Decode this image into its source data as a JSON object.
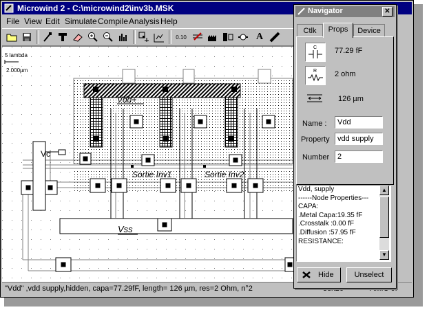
{
  "window": {
    "title": "Microwind 2 - C:\\microwind2\\inv3b.MSK"
  },
  "menu": [
    "File",
    "View",
    "Edit",
    "Simulate",
    "Compile",
    "Analysis",
    "Help"
  ],
  "toolbar": {
    "icons": [
      "open-folder-icon",
      "save-icon",
      "draw-box-icon",
      "draw-contact-icon",
      "eraser-icon",
      "zoom-in-icon",
      "zoom-out-icon",
      "view-all-icon",
      "simulate-icon",
      "measure-icon",
      "rotate-icon",
      "bus-icon",
      "process-icon",
      "wire-icon",
      "text-icon",
      "cut-icon"
    ],
    "scale_label": "0.10"
  },
  "canvas": {
    "scale_lambda": "5 lambda",
    "scale_um": "2.000µm",
    "labels": {
      "vdd": "Vdd+",
      "vc": "Vc",
      "sortie1": "Sortie Inv1",
      "sortie2": "Sortie Inv2",
      "vss": "Vss"
    }
  },
  "status": {
    "message": "\"Vdd\" ,vdd supply,hidden, capa=77.29fF, length= 126 µm, res=2 Ohm, n°2",
    "size": "38x26",
    "process": "AMIC 0."
  },
  "navigator": {
    "title": "Navigator",
    "tabs": [
      "Ctlk",
      "Props",
      "Device"
    ],
    "active_tab": "Props",
    "capacitance": "77.29 fF",
    "resistance": "2 ohm",
    "length": "126 µm",
    "name_label": "Name :",
    "name_value": "Vdd",
    "property_label": "Property",
    "property_value": "vdd supply",
    "number_label": "Number",
    "number_value": "2",
    "info_lines": [
      "Vdd, supply",
      "",
      "------Node Properties---",
      "CAPA:",
      ".Metal Capa:19.35 fF",
      ".Crosstalk :0.00 fF",
      ".Diffusion :57.95 fF",
      "RESISTANCE:"
    ],
    "hide_label": "Hide",
    "unselect_label": "Unselect"
  },
  "colors": {
    "titlebar_active": "#000080",
    "titlebar_inactive": "#808080",
    "face": "#c0c0c0"
  }
}
